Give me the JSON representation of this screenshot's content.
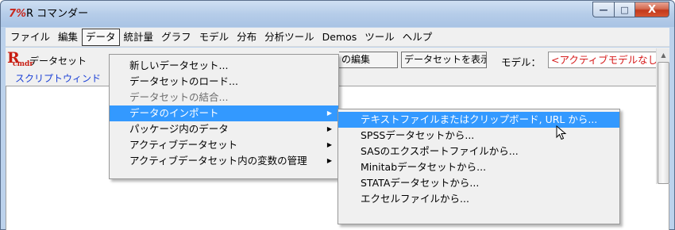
{
  "window": {
    "icon": "7%",
    "title": "R コマンダー",
    "buttons": {
      "minimize": "—",
      "maximize": "□",
      "close": "X"
    }
  },
  "menubar": {
    "items": [
      {
        "label": "ファイル"
      },
      {
        "label": "編集"
      },
      {
        "label": "データ",
        "active": true
      },
      {
        "label": "統計量"
      },
      {
        "label": "グラフ"
      },
      {
        "label": "モデル"
      },
      {
        "label": "分布"
      },
      {
        "label": "分析ツール"
      },
      {
        "label": "Demos"
      },
      {
        "label": "ツール"
      },
      {
        "label": "ヘルプ"
      }
    ]
  },
  "toolbar": {
    "logo_big": "R",
    "logo_small": "cmdr",
    "dataset_label": "データセット",
    "edit_button": "の編集",
    "view_button": "データセットを表示",
    "model_label": "モデル：",
    "model_value": "<アクティブモデルなし>"
  },
  "tabs": {
    "script": "スクリプトウィンド"
  },
  "data_menu": {
    "items": [
      {
        "label": "新しいデータセット..."
      },
      {
        "label": "データセットのロード..."
      },
      {
        "label": "データセットの結合...",
        "disabled": true
      },
      {
        "label": "データのインポート",
        "submenu": true,
        "highlight": true
      },
      {
        "label": "パッケージ内のデータ",
        "submenu": true
      },
      {
        "label": "アクティブデータセット",
        "submenu": true
      },
      {
        "label": "アクティブデータセット内の変数の管理",
        "submenu": true
      }
    ]
  },
  "import_submenu": {
    "items": [
      {
        "label": "テキストファイルまたはクリップボード, URL から...",
        "highlight": true
      },
      {
        "label": "SPSSデータセットから..."
      },
      {
        "label": "SASのエクスポートファイルから..."
      },
      {
        "label": "Minitabデータセットから..."
      },
      {
        "label": "STATAデータセットから..."
      },
      {
        "label": "エクセルファイルから..."
      }
    ]
  },
  "icons": {
    "submenu_arrow": "▶",
    "scroll_up": "▲"
  }
}
